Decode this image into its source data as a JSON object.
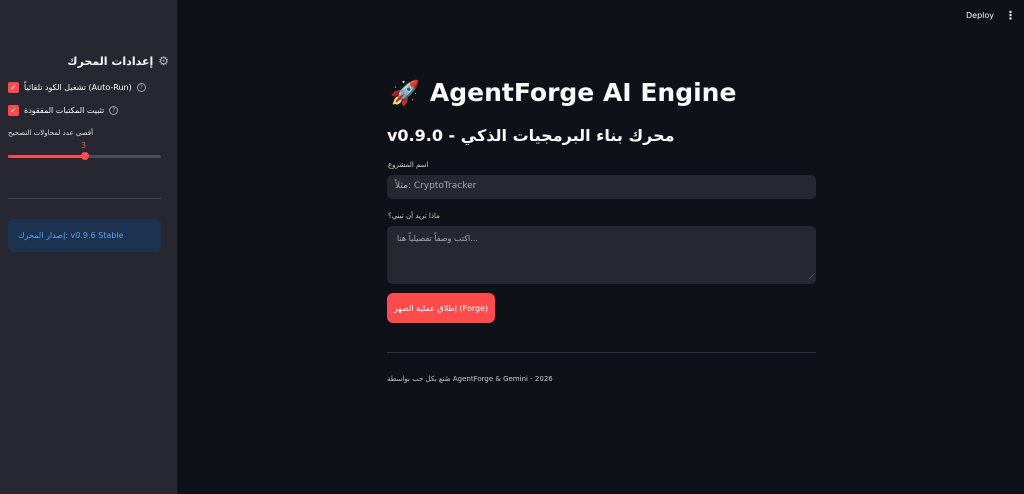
{
  "sidebar": {
    "header_title": "إعدادات المحرك",
    "header_icon": "gear-icon",
    "checkboxes": [
      {
        "label": "تشغيل الكود تلقائياً (Auto-Run)",
        "checked": true
      },
      {
        "label": "تثبيت المكتبات المفقودة",
        "checked": true
      }
    ],
    "slider": {
      "label": "أقصى عدد لمحاولات التصحيح",
      "value": "3",
      "fraction": 0.5
    },
    "info_box": "إصدار المحرك: v0.9.6 Stable"
  },
  "topbar": {
    "deploy_label": "Deploy",
    "menu_icon": "⋮"
  },
  "main": {
    "title_icon": "🚀",
    "title": "AgentForge AI Engine",
    "subtitle": "v0.9.0 - محرك بناء البرمجيات الذكي",
    "project_label": "اسم المشروع",
    "project_placeholder": "مثلاً: CryptoTracker",
    "goal_label": "ماذا تريد أن تبني؟",
    "goal_placeholder": "اكتب وصفاً تفصيلياً هنا...",
    "forge_button": "إطلاق عملية الصهر (Forge)",
    "footer": "صُنع بكل حب بواسطة AgentForge & Gemini - 2026"
  },
  "colors": {
    "accent": "#ff4b4b",
    "background": "#0e1117",
    "sidebar": "#262730",
    "info_bg": "#1c3250",
    "info_text": "#5aa4e8"
  }
}
